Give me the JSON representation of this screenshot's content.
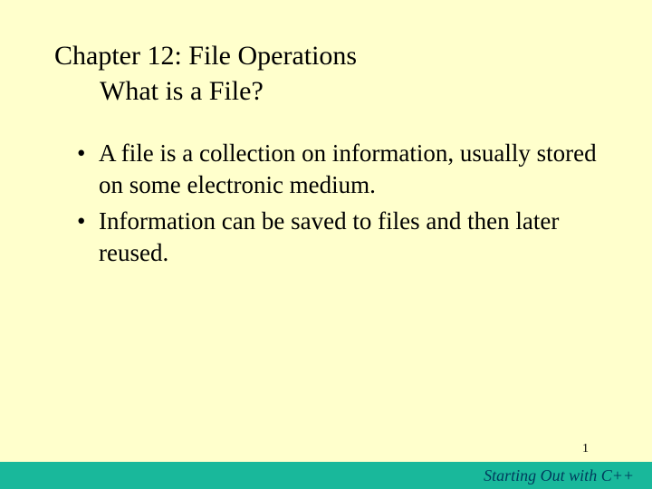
{
  "title": {
    "line1": "Chapter 12: File Operations",
    "line2": "What is a File?"
  },
  "bullets": [
    "A file is a collection on information, usually stored on some electronic medium.",
    "Information can be saved to files and then later reused."
  ],
  "page_number": "1",
  "footer_text": "Starting Out with C++"
}
